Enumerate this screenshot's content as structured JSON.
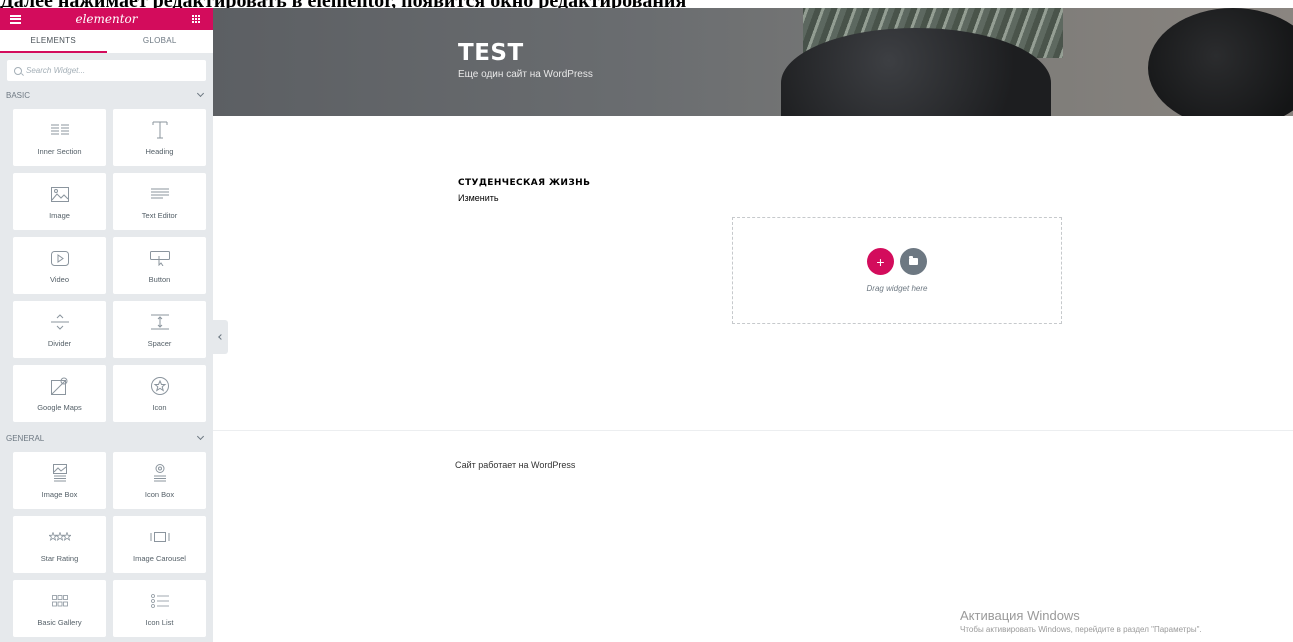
{
  "caption": "Далее нажимает редактировать в elementor, появится окно редактирования",
  "sidebar": {
    "logo": "elementor",
    "tabs": [
      {
        "label": "ELEMENTS",
        "active": true
      },
      {
        "label": "GLOBAL",
        "active": false
      }
    ],
    "search_placeholder": "Search Widget...",
    "categories": [
      {
        "name": "BASIC",
        "widgets": [
          {
            "label": "Inner Section",
            "icon": "columns-icon"
          },
          {
            "label": "Heading",
            "icon": "heading-icon"
          },
          {
            "label": "Image",
            "icon": "image-icon"
          },
          {
            "label": "Text Editor",
            "icon": "text-editor-icon"
          },
          {
            "label": "Video",
            "icon": "video-icon"
          },
          {
            "label": "Button",
            "icon": "button-icon"
          },
          {
            "label": "Divider",
            "icon": "divider-icon"
          },
          {
            "label": "Spacer",
            "icon": "spacer-icon"
          },
          {
            "label": "Google Maps",
            "icon": "map-icon"
          },
          {
            "label": "Icon",
            "icon": "star-circle-icon"
          }
        ]
      },
      {
        "name": "GENERAL",
        "widgets": [
          {
            "label": "Image Box",
            "icon": "image-box-icon"
          },
          {
            "label": "Icon Box",
            "icon": "icon-box-icon"
          },
          {
            "label": "Star Rating",
            "icon": "star-rating-icon"
          },
          {
            "label": "Image Carousel",
            "icon": "carousel-icon"
          },
          {
            "label": "Basic Gallery",
            "icon": "gallery-icon"
          },
          {
            "label": "Icon List",
            "icon": "list-icon"
          }
        ]
      }
    ],
    "accent_color": "#d30c5c"
  },
  "header": {
    "site_title": "TEST",
    "site_description": "Еще один сайт на WordPress"
  },
  "content": {
    "section_title": "СТУДЕНЧЕСКАЯ ЖИЗНЬ",
    "edit_link": "Изменить",
    "dropzone": {
      "add_symbol": "+",
      "text": "Drag widget here"
    }
  },
  "footer": {
    "text": "Сайт работает на WordPress"
  },
  "windows_activation": {
    "title": "Активация Windows",
    "subtitle": "Чтобы активировать Windows, перейдите в раздел \"Параметры\"."
  }
}
